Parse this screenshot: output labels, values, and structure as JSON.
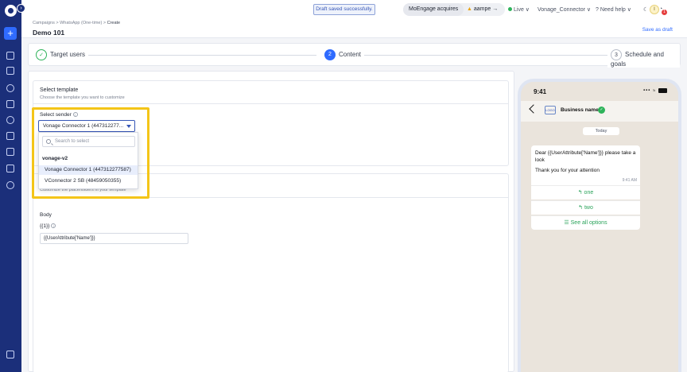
{
  "header": {
    "breadcrumb": [
      "Campaigns",
      "WhatsApp (One-time)",
      "Create"
    ],
    "breadcrumb_sep": ">",
    "title": "Demo 101",
    "toast": "Draft saved successfully.",
    "acquires_left": "MoEngage acquires",
    "acquires_right": "aampe",
    "acquires_mark": "▲",
    "acquires_arrow": "→",
    "env": "Live",
    "workspace": "Vonage_Connector",
    "help": "Need help",
    "save_draft": "Save as draft",
    "avatar": "I",
    "notif_count": "1",
    "chev": "∨",
    "question": "?"
  },
  "stepper": {
    "steps": [
      {
        "label": "Target users",
        "marker": "✓",
        "state": "done"
      },
      {
        "label": "Content",
        "marker": "2",
        "state": "active"
      },
      {
        "label": "Schedule and goals",
        "marker": "3",
        "state": "pending"
      }
    ]
  },
  "template": {
    "title": "Select template",
    "subtitle": "Choose the template you want to customize"
  },
  "sender": {
    "label": "Select sender",
    "info": "i",
    "selected": "Vonage Connector 1 (447312277...",
    "search_placeholder": "Search to select",
    "group": "vonage-v2",
    "options": [
      "Vonage Connector 1 (447312277587)",
      "VConnector 2 SB (48459050355)"
    ]
  },
  "personalize": {
    "subtitle": "Customize the placeholders in your template",
    "body_label": "Body",
    "var_label": "{{1}}",
    "info": "i",
    "var_value": "{{UserAttribute['Name']}}"
  },
  "preview": {
    "time": "9:41",
    "status": "••• ≈",
    "business_name": "Business name",
    "business_logo": "LOGO",
    "verified": "✓",
    "date_chip": "Today",
    "message_line1": "Dear {{UserAttribute['Name']}} please take a look",
    "message_line2": "Thank you for your attention",
    "message_time": "9:41 AM",
    "quick_replies": [
      "↰ one",
      "↰ two"
    ],
    "see_all": "☰ See all options"
  }
}
